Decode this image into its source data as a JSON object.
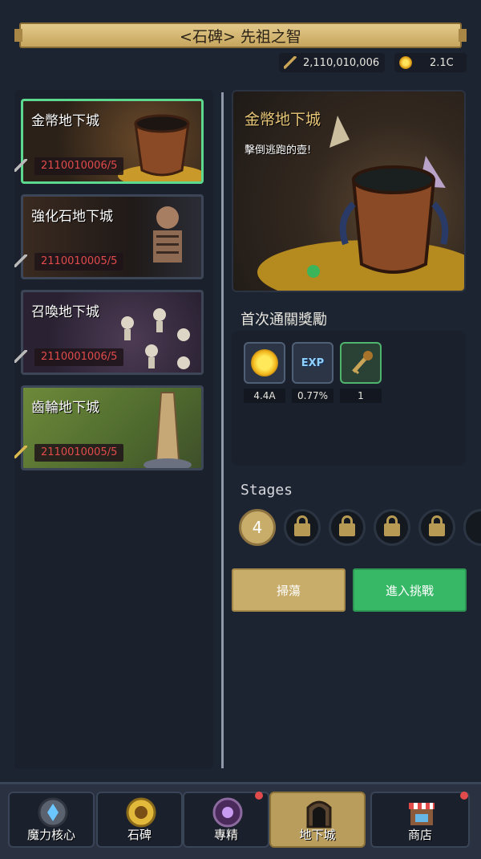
{
  "header": {
    "title": "<石碑> 先祖之智"
  },
  "currency": {
    "keys": "2,110,010,006",
    "gold": "2.1C"
  },
  "dungeons": [
    {
      "name": "金幣地下城",
      "count": "2110010006/5",
      "selected": true
    },
    {
      "name": "強化石地下城",
      "count": "2110010005/5",
      "selected": false
    },
    {
      "name": "召喚地下城",
      "count": "2110001006/5",
      "selected": false
    },
    {
      "name": "齒輪地下城",
      "count": "2110010005/5",
      "selected": false
    }
  ],
  "preview": {
    "title": "金幣地下城",
    "description": "擊倒逃跑的壺!"
  },
  "rewards": {
    "heading": "首次通關獎勵",
    "items": [
      {
        "icon": "gold-coin-icon",
        "value": "4.4A"
      },
      {
        "icon": "exp-icon",
        "label": "EXP",
        "value": "0.77%"
      },
      {
        "icon": "key-icon",
        "value": "1"
      }
    ]
  },
  "stages": {
    "label": "Stages",
    "current": "4",
    "locked_count": 5
  },
  "actions": {
    "sweep": "掃蕩",
    "enter": "進入挑戰"
  },
  "nav": [
    {
      "label": "魔力核心",
      "icon": "magic-core-icon",
      "notify": false,
      "active": false
    },
    {
      "label": "石碑",
      "icon": "sun-tablet-icon",
      "notify": false,
      "active": false
    },
    {
      "label": "專精",
      "icon": "rune-icon",
      "notify": true,
      "active": false
    },
    {
      "label": "地下城",
      "icon": "dungeon-gate-icon",
      "notify": false,
      "active": true
    },
    {
      "label": "商店",
      "icon": "shop-icon",
      "notify": true,
      "active": false
    }
  ],
  "colors": {
    "accent_gold": "#c8ad6a",
    "accent_green": "#37b866",
    "count_red": "#e14b4b"
  }
}
